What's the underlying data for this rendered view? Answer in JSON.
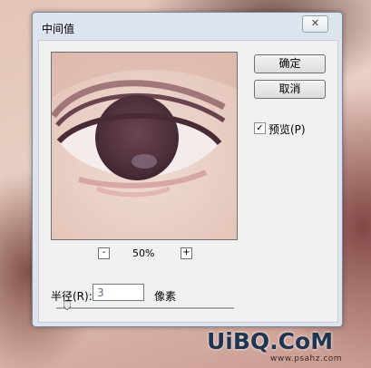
{
  "dialog": {
    "title": "中间值",
    "close_icon": "close-icon",
    "ok_label": "确定",
    "cancel_label": "取消",
    "preview_label": "预览(P)",
    "preview_checked": true,
    "zoom": {
      "minus": "-",
      "plus": "+",
      "value": "50%"
    },
    "radius": {
      "label": "半径(R):",
      "value": "3",
      "unit": "像素",
      "slider_level_fraction": 0.06
    }
  },
  "watermark": {
    "logo_text": "UiBQ.CoM",
    "url_text": "www.psahz.com"
  },
  "colors": {
    "dialog_frame": "#dde4ee",
    "client_bg": "#f0f0f0"
  }
}
